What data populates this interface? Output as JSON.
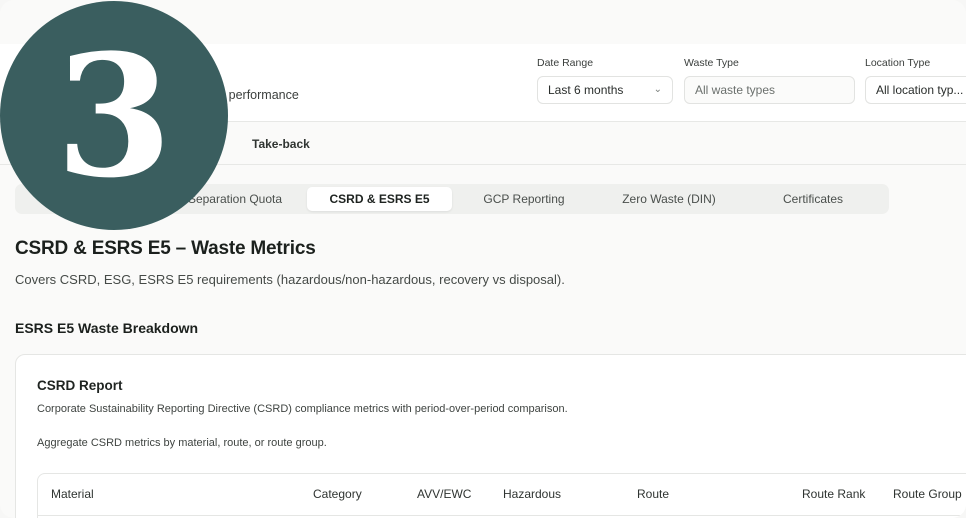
{
  "header": {
    "subtitle": "ons performance",
    "filters": [
      {
        "label": "Date Range",
        "value": "Last 6 months",
        "placeholder": false
      },
      {
        "label": "Waste Type",
        "value": "All waste types",
        "placeholder": true
      },
      {
        "label": "Location Type",
        "value": "All location typ...",
        "placeholder": false
      }
    ]
  },
  "nav": {
    "take_back": "Take-back"
  },
  "tabs": [
    {
      "label": "Separation Quota",
      "active": false
    },
    {
      "label": "CSRD & ESRS E5",
      "active": true
    },
    {
      "label": "GCP Reporting",
      "active": false
    },
    {
      "label": "Zero Waste (DIN)",
      "active": false
    },
    {
      "label": "Certificates",
      "active": false
    }
  ],
  "main": {
    "title": "CSRD & ESRS E5 – Waste Metrics",
    "description": "Covers CSRD, ESG, ESRS E5 requirements (hazardous/non-hazardous, recovery vs disposal).",
    "section_title": "ESRS E5 Waste Breakdown"
  },
  "card": {
    "title": "CSRD Report",
    "description": "Corporate Sustainability Reporting Directive (CSRD) compliance metrics with period-over-period comparison.",
    "description2": "Aggregate CSRD metrics by material, route, or route group.",
    "columns": [
      "Material",
      "Category",
      "AVV/EWC",
      "Hazardous",
      "Route",
      "Route Rank",
      "Route Group"
    ]
  },
  "badge": {
    "number": "3",
    "color": "#3a5e5f"
  }
}
